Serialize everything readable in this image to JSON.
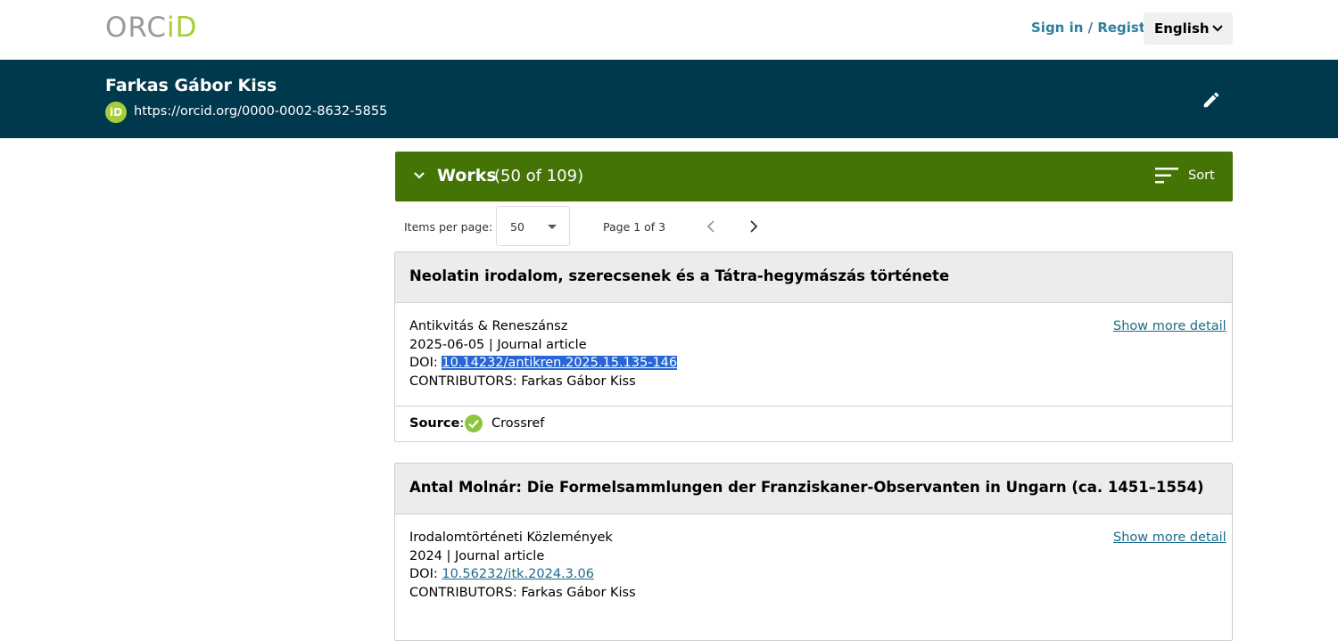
{
  "topbar": {
    "logo_text_a": "ORC",
    "logo_text_b": "iD",
    "signin_label": "Sign in / Register",
    "language": "English"
  },
  "header": {
    "name": "Farkas Gábor Kiss",
    "badge": "iD",
    "orcid_url": "https://orcid.org/0000-0002-8632-5855"
  },
  "works": {
    "title": "Works",
    "count": "(50 of 109)",
    "sort_label": "Sort"
  },
  "pager": {
    "items_label": "Items per page:",
    "items_value": "50",
    "page_range": "Page 1 of 3"
  },
  "cards": [
    {
      "title": "Neolatin irodalom, szerecsenek és a Tátra-hegymászás története",
      "journal": "Antikvitás & Reneszánsz",
      "meta": "2025-06-05 | Journal article",
      "doi_label": "DOI: ",
      "doi": "10.14232/antikren.2025.15.135-146",
      "contributors": "CONTRIBUTORS: Farkas Gábor Kiss",
      "more": "Show more detail",
      "source_label": "Source",
      "source_sep": ":",
      "source": "Crossref"
    },
    {
      "title": "Antal Molnár: Die Formelsammlungen der Franziskaner-Observanten in Ungarn (ca. 1451–1554)",
      "journal": "Irodalomtörténeti Közlemények",
      "meta": "2024 | Journal article",
      "doi_label": "DOI: ",
      "doi": "10.56232/itk.2024.3.06",
      "contributors": "CONTRIBUTORS: Farkas Gábor Kiss",
      "more": "Show more detail"
    }
  ],
  "colors": {
    "header_bg": "#00384d",
    "works_bar": "#447405",
    "orcid_green": "#a6ce39",
    "link": "#1c6a8a"
  }
}
